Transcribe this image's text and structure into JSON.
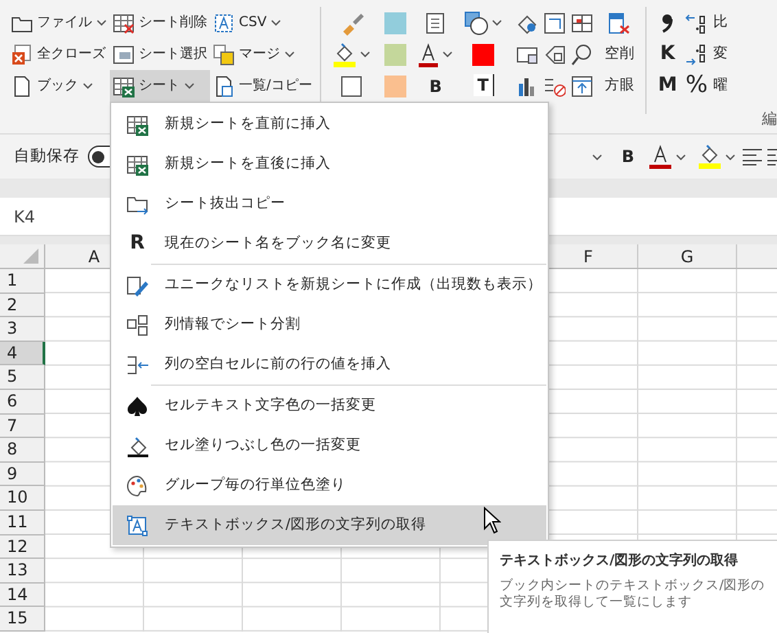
{
  "ribbon": {
    "commands": [
      [
        {
          "label": "ファイル",
          "dropdown": true,
          "selected": false
        },
        {
          "label": "全クローズ",
          "dropdown": false,
          "selected": false
        },
        {
          "label": "ブック",
          "dropdown": true,
          "selected": false
        }
      ],
      [
        {
          "label": "シート削除",
          "dropdown": false,
          "selected": false
        },
        {
          "label": "シート選択",
          "dropdown": false,
          "selected": false
        },
        {
          "label": "シート",
          "dropdown": true,
          "selected": true
        }
      ],
      [
        {
          "label": "CSV",
          "dropdown": true,
          "selected": false
        },
        {
          "label": "マージ",
          "dropdown": true,
          "selected": false
        },
        {
          "label": "一覧/コピー",
          "dropdown": false,
          "selected": false
        }
      ]
    ],
    "swatches": [
      {
        "color": "#92cddc"
      },
      {
        "color": "#c4d79b"
      },
      {
        "color": "#fabf8f"
      }
    ],
    "bold_button": "B",
    "textbox_button": "T",
    "fill_swatch": {
      "color": "#ff0000"
    },
    "text_buttons": [
      "空削",
      "方眼"
    ],
    "letter_buttons": [
      "K",
      "M"
    ],
    "percent_button": "%",
    "cut_labels": [
      "比",
      "変",
      "曜"
    ],
    "group_label": "編"
  },
  "quick_access": {
    "autosave": {
      "label": "自動保存",
      "on": false
    },
    "bold": "B"
  },
  "name_box": "K4",
  "columns": [
    "A",
    "F",
    "G"
  ],
  "rows": [
    {
      "label": "1",
      "selected": false
    },
    {
      "label": "2",
      "selected": false
    },
    {
      "label": "3",
      "selected": false
    },
    {
      "label": "4",
      "selected": true
    },
    {
      "label": "5",
      "selected": false
    },
    {
      "label": "6",
      "selected": false
    },
    {
      "label": "7",
      "selected": false
    },
    {
      "label": "8",
      "selected": false
    },
    {
      "label": "9",
      "selected": false
    },
    {
      "label": "10",
      "selected": false
    },
    {
      "label": "11",
      "selected": false
    },
    {
      "label": "12",
      "selected": false
    },
    {
      "label": "13",
      "selected": false
    },
    {
      "label": "14",
      "selected": false
    },
    {
      "label": "15",
      "selected": false
    }
  ],
  "menu": {
    "groups": [
      [
        {
          "label": "新規シートを直前に挿入",
          "selected": false
        },
        {
          "label": "新規シートを直後に挿入",
          "selected": false
        },
        {
          "label": "シート抜出コピー",
          "selected": false
        },
        {
          "label": "現在のシート名をブック名に変更",
          "icon_letter": "R",
          "selected": false
        }
      ],
      [
        {
          "label": "ユニークなリストを新規シートに作成（出現数も表示）",
          "selected": false
        },
        {
          "label": "列情報でシート分割",
          "selected": false
        },
        {
          "label": "列の空白セルに前の行の値を挿入",
          "selected": false
        }
      ],
      [
        {
          "label": "セルテキスト文字色の一括変更",
          "selected": false
        },
        {
          "label": "セル塗りつぶし色の一括変更",
          "selected": false
        },
        {
          "label": "グループ毎の行単位色塗り",
          "selected": false
        },
        {
          "label": "テキストボックス/図形の文字列の取得",
          "selected": true
        }
      ]
    ]
  },
  "tooltip": {
    "title": "テキストボックス/図形の文字列の取得",
    "description": "ブック内シートのテキストボックス/図形の文字列を取得して一覧にします"
  }
}
